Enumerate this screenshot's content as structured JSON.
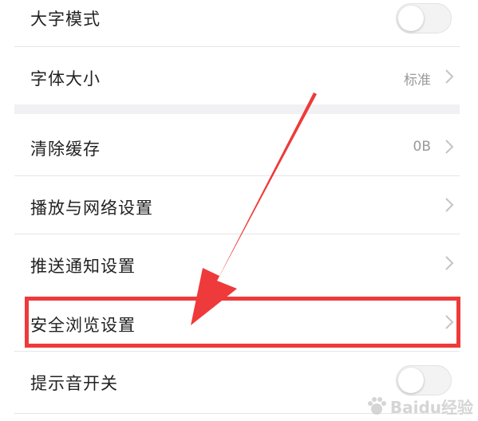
{
  "settings": {
    "rows": [
      {
        "label": "大字模式",
        "control": "toggle",
        "toggle_on": false
      },
      {
        "label": "字体大小",
        "value": "标准"
      },
      {
        "label": "清除缓存",
        "value": "0B"
      },
      {
        "label": "播放与网络设置"
      },
      {
        "label": "推送通知设置"
      },
      {
        "label": "安全浏览设置",
        "highlighted": true
      },
      {
        "label": "提示音开关",
        "control": "toggle",
        "toggle_on": false
      }
    ]
  },
  "annotation": {
    "color": "#ee3a3a"
  },
  "watermark": {
    "brand": "Baidu经验"
  }
}
